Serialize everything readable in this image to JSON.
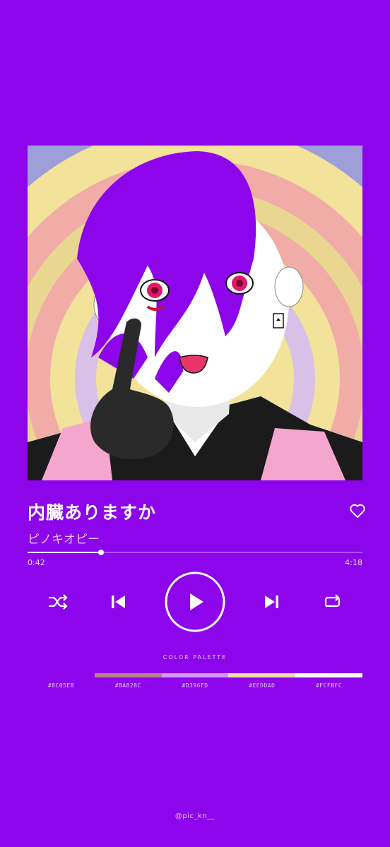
{
  "song": {
    "title": "内臓ありますか",
    "artist": "ピノキオピー"
  },
  "playback": {
    "current_time": "0:42",
    "total_time": "4:18",
    "progress_fraction": 0.22
  },
  "palette": {
    "heading": "COLOR PALETTE",
    "colors": [
      "#8C05EB",
      "#BA828C",
      "#D396FD",
      "#EEDDAD",
      "#FCFBFC"
    ],
    "labels": [
      "#8C05EB",
      "#BA828C",
      "#D396FD",
      "#EEDDAD",
      "#FCFBFC"
    ]
  },
  "footer": {
    "handle": "@pic_kn__"
  },
  "icons": {
    "like": "heart-outline-icon",
    "shuffle": "shuffle-icon",
    "previous": "skip-previous-icon",
    "play": "play-icon",
    "next": "skip-next-icon",
    "repeat": "repeat-icon"
  },
  "theme": {
    "background": "#8C05EB",
    "accent": "#FFFFFF"
  }
}
